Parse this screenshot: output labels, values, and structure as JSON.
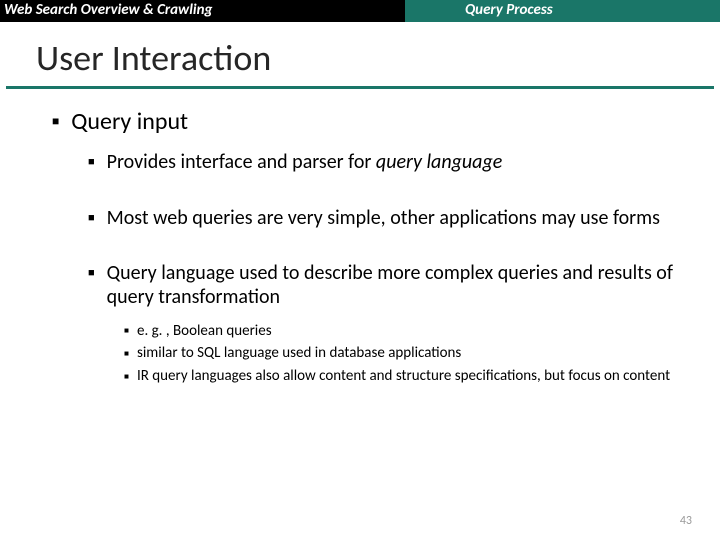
{
  "header": {
    "left": "Web Search Overview & Crawling",
    "right": "Query Process"
  },
  "title": "User Interaction",
  "bullets": {
    "l1": "Query input",
    "l2a_pre": "Provides interface and parser for ",
    "l2a_em": "query language",
    "l2b": "Most web queries are very simple, other applications may use forms",
    "l2c": "Query language used to describe more complex queries and results of query transformation",
    "l3a": "e. g. , Boolean queries",
    "l3b": "similar to SQL language used in database applications",
    "l3c": "IR query languages also allow content and structure specifications, but focus on content"
  },
  "page": "43"
}
